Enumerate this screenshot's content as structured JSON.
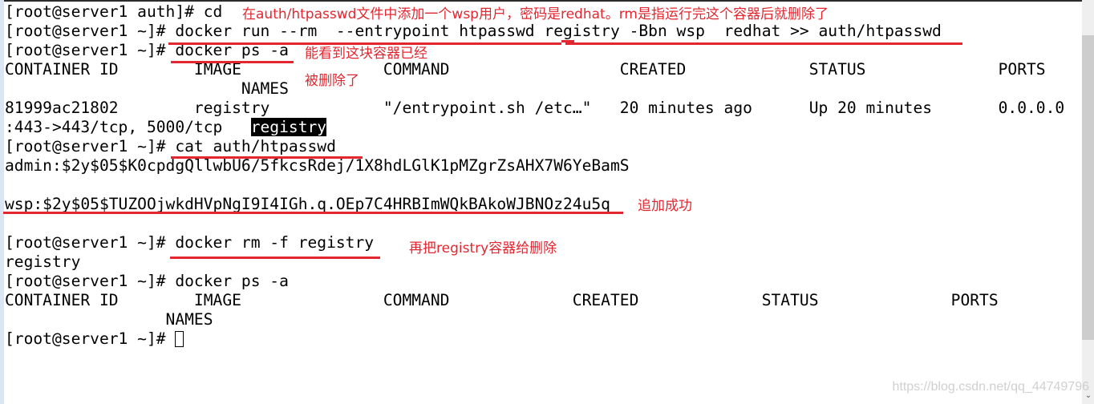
{
  "terminal": {
    "lines": [
      {
        "prompt": "[root@server1 auth]# ",
        "cmd": "cd"
      },
      {
        "prompt": "[root@server1 ~]# ",
        "cmd": "docker run --rm  --entrypoint htpasswd registry -Bbn wsp  redhat >> auth/htpasswd"
      },
      {
        "prompt": "[root@server1 ~]# ",
        "cmd": "docker ps -a"
      },
      {
        "text": "CONTAINER ID        IMAGE               COMMAND                  CREATED             STATUS              PORTS"
      },
      {
        "text": "                         NAMES"
      },
      {
        "text": "81999ac21802        registry            \"/entrypoint.sh /etc…\"   20 minutes ago      Up 20 minutes       0.0.0.0"
      },
      {
        "text": ":443->443/tcp, 5000/tcp   ",
        "highlight": "registry"
      },
      {
        "prompt": "[root@server1 ~]# ",
        "cmd": "cat auth/htpasswd"
      },
      {
        "text": "admin:$2y$05$K0cpdgQllwbU6/5fkcsRdej/1X8hdLGlK1pMZgrZsAHX7W6YeBamS"
      },
      {
        "text": ""
      },
      {
        "text": "wsp:$2y$05$TUZOOjwkdHVpNgI9I4IGh.q.OEp7C4HRBImWQkBAkoWJBNOz24u5q"
      },
      {
        "text": ""
      },
      {
        "prompt": "[root@server1 ~]# ",
        "cmd": "docker rm -f registry"
      },
      {
        "text": "registry"
      },
      {
        "prompt": "[root@server1 ~]# ",
        "cmd": "docker ps -a"
      },
      {
        "text": "CONTAINER ID        IMAGE               COMMAND             CREATED             STATUS              PORTS"
      },
      {
        "text": "                 NAMES"
      },
      {
        "prompt": "[root@server1 ~]# ",
        "cmd": ""
      }
    ]
  },
  "annotations": {
    "note_htpasswd": "在auth/htpasswd文件中添加一个wsp用户，密码是redhat。rm是指运行完这个容器后就删除了",
    "note_ps_line1": "能看到这块容器已经",
    "note_ps_line2": "被删除了",
    "note_append_success": "追加成功",
    "note_rm_registry": "再把registry容器给删除"
  },
  "colors": {
    "annotation": "#e3262f",
    "terminal_bg": "#ffffff",
    "terminal_fg": "#000000"
  },
  "watermark": "https://blog.csdn.net/qq_44749796"
}
